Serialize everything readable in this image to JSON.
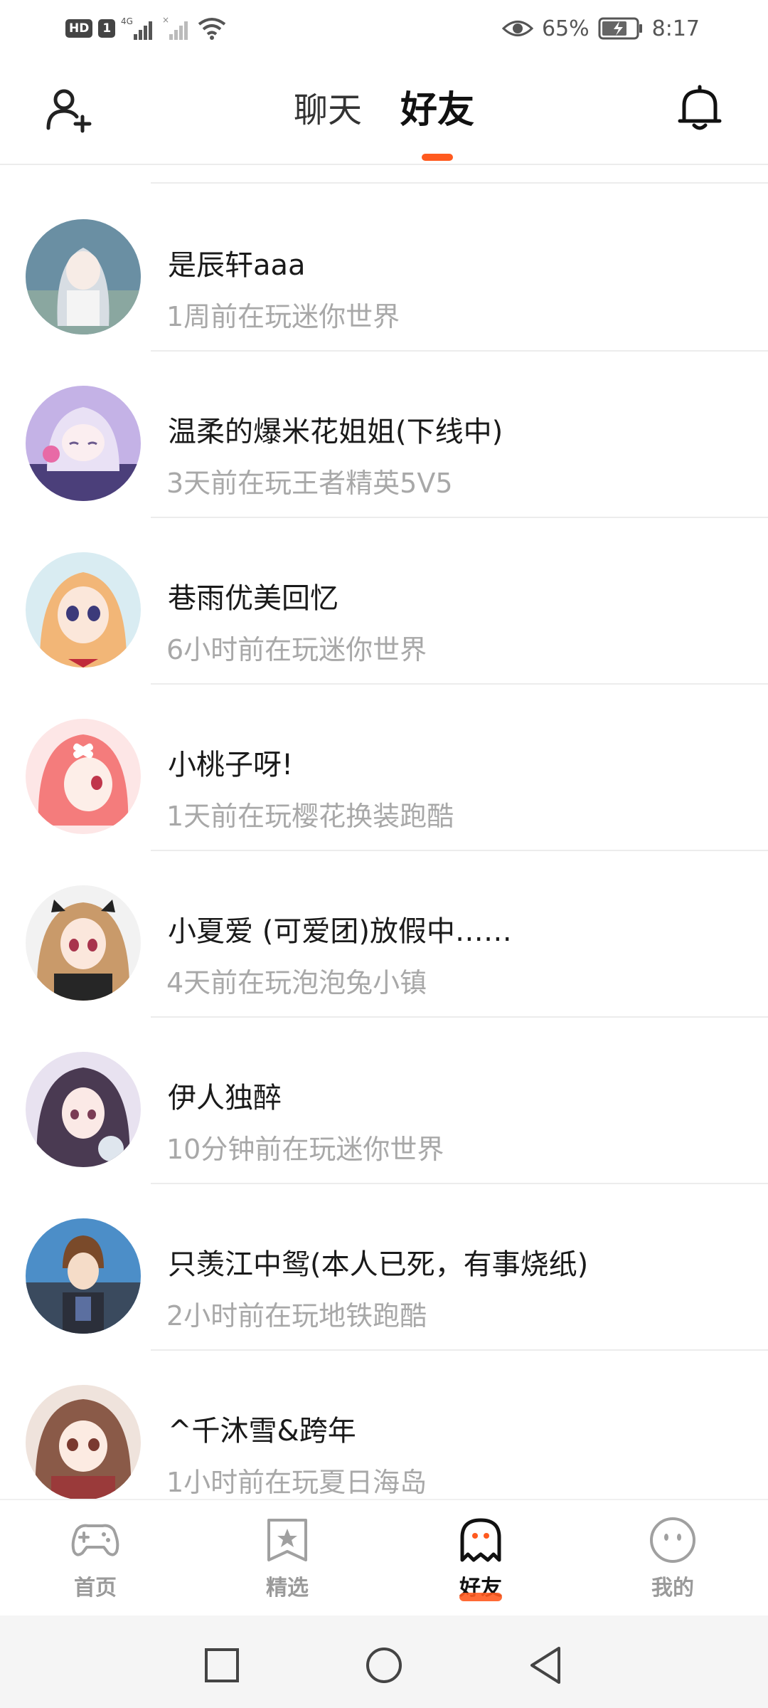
{
  "status_bar": {
    "hd": "HD",
    "sim": "1",
    "net": "4G",
    "battery": "65%",
    "time": "8:17"
  },
  "header": {
    "tabs": [
      {
        "label": "聊天",
        "active": false
      },
      {
        "label": "好友",
        "active": true
      }
    ]
  },
  "friends": [
    {
      "name": "是辰轩aaa",
      "status": "1周前在玩迷你世界"
    },
    {
      "name": "温柔的爆米花姐姐(下线中)",
      "status": "3天前在玩王者精英5V5"
    },
    {
      "name": "巷雨优美回忆",
      "status": "6小时前在玩迷你世界"
    },
    {
      "name": "小桃子呀!",
      "status": "1天前在玩樱花换装跑酷"
    },
    {
      "name": "小夏爱 (可爱团)放假中……",
      "status": "4天前在玩泡泡兔小镇"
    },
    {
      "name": "伊人独醉",
      "status": "10分钟前在玩迷你世界"
    },
    {
      "name": "只羡江中鸳(本人已死，有事烧纸)",
      "status": "2小时前在玩地铁跑酷"
    },
    {
      "name": "^千沐雪&跨年",
      "status": "1小时前在玩夏日海岛"
    }
  ],
  "bottom_nav": [
    {
      "label": "首页",
      "icon": "gamepad-icon"
    },
    {
      "label": "精选",
      "icon": "star-bookmark-icon"
    },
    {
      "label": "好友",
      "icon": "ghost-icon",
      "active": true
    },
    {
      "label": "我的",
      "icon": "face-icon"
    }
  ],
  "colors": {
    "accent": "#ff5a1f",
    "secondary_text": "#a8a8a8"
  }
}
